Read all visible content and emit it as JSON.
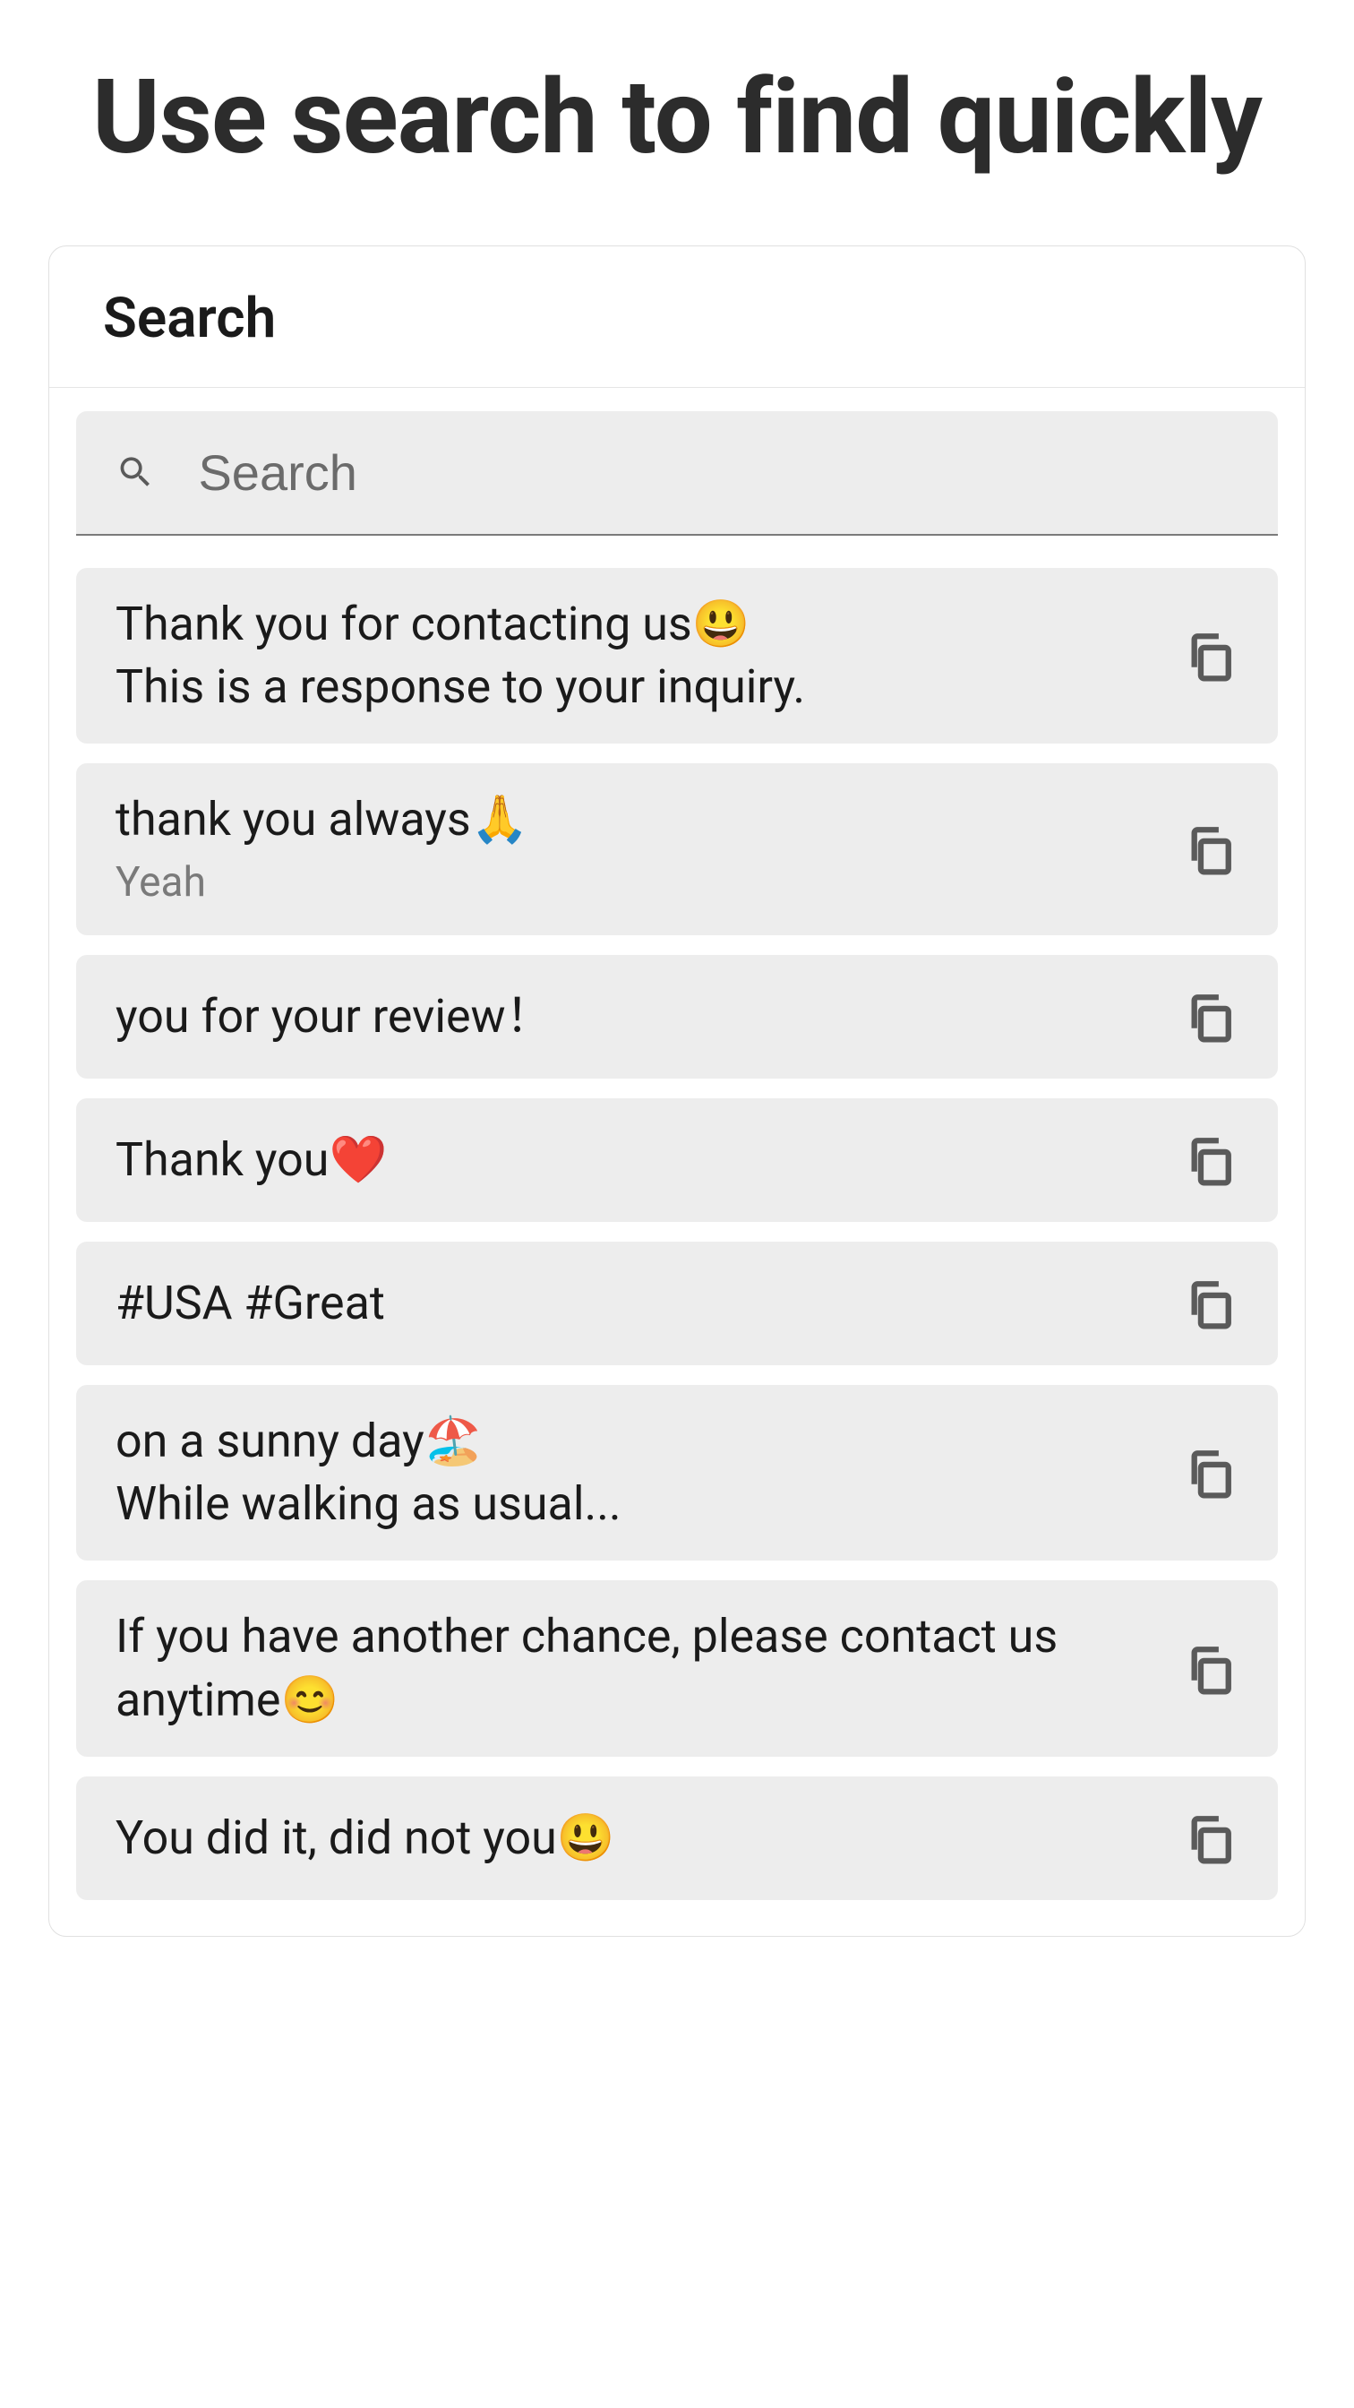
{
  "hero": {
    "title": "Use search to find quickly"
  },
  "app": {
    "header_title": "Search",
    "search_placeholder": "Search"
  },
  "items": [
    {
      "primary": "Thank you for contacting us😃\nThis is a response to your inquiry.",
      "secondary": ""
    },
    {
      "primary": "thank you always🙏",
      "secondary": "Yeah"
    },
    {
      "primary": " you for your review！",
      "secondary": ""
    },
    {
      "primary": "Thank you❤️",
      "secondary": ""
    },
    {
      "primary": "#USA    #Great",
      "secondary": ""
    },
    {
      "primary": "on a sunny day🏖️\nWhile walking as usual...",
      "secondary": ""
    },
    {
      "primary": "If you have another chance, please contact us anytime😊",
      "secondary": ""
    },
    {
      "primary": "You did it, did not you😃",
      "secondary": ""
    }
  ]
}
